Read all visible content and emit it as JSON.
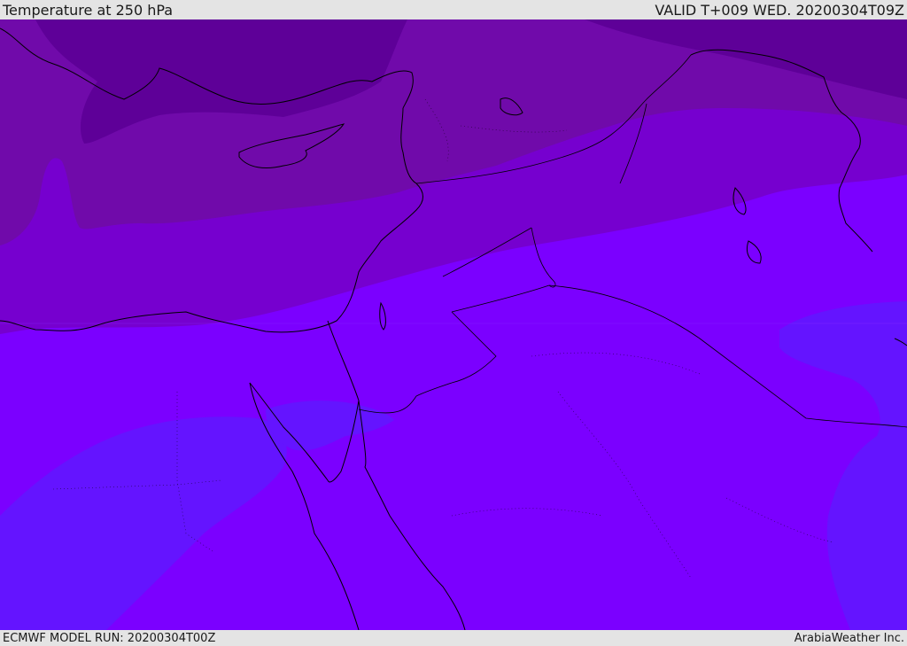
{
  "header": {
    "title": "Temperature at 250 hPa",
    "valid_time": "VALID T+009 WED. 20200304T09Z"
  },
  "footer": {
    "model_run": "ECMWF MODEL RUN: 20200304T00Z",
    "credit": "ArabiaWeather Inc."
  },
  "map": {
    "field": "Temperature at 250 hPa",
    "colors": {
      "coldest_band": "#5e0098",
      "cold_band": "#700aaa",
      "mid_band": "#7600cf",
      "main_band": "#7b00ff",
      "warm_band": "#6414ff",
      "coastline": "#000000"
    }
  }
}
